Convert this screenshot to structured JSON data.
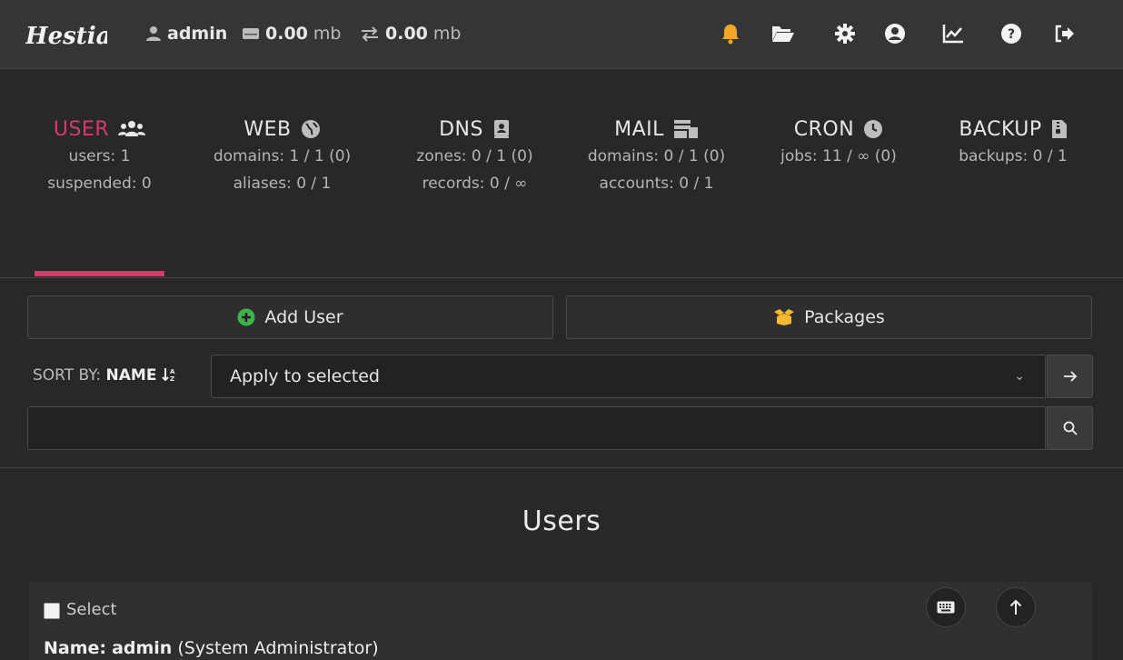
{
  "topbar": {
    "logo_text": "Hestia",
    "user": "admin",
    "disk_value": "0.00",
    "disk_unit": "mb",
    "bandwidth_value": "0.00",
    "bandwidth_unit": "mb"
  },
  "tabs": [
    {
      "title": "USER",
      "lines": [
        "users: 1",
        "suspended: 0"
      ],
      "active": true
    },
    {
      "title": "WEB",
      "lines": [
        "domains: 1 / 1 (0)",
        "aliases: 0 / 1"
      ]
    },
    {
      "title": "DNS",
      "lines": [
        "zones: 0 / 1 (0)",
        "records: 0 / ∞"
      ]
    },
    {
      "title": "MAIL",
      "lines": [
        "domains: 0 / 1 (0)",
        "accounts: 0 / 1"
      ]
    },
    {
      "title": "CRON",
      "lines": [
        "jobs: 11 / ∞ (0)"
      ]
    },
    {
      "title": "BACKUP",
      "lines": [
        "backups: 0 / 1"
      ]
    }
  ],
  "actions": {
    "add_user": "Add User",
    "packages": "Packages"
  },
  "sort": {
    "label": "SORT BY:",
    "field": "NAME"
  },
  "bulk": {
    "selected": "Apply to selected"
  },
  "search": {
    "value": ""
  },
  "heading": "Users",
  "user_card": {
    "select_label": "Select",
    "name_label": "Name:",
    "name": "admin",
    "role": "(System Administrator)"
  },
  "colors": {
    "accent": "#d63a6a",
    "bell": "#f5a623",
    "add": "#3cb44b",
    "packages": "#f5b931"
  }
}
